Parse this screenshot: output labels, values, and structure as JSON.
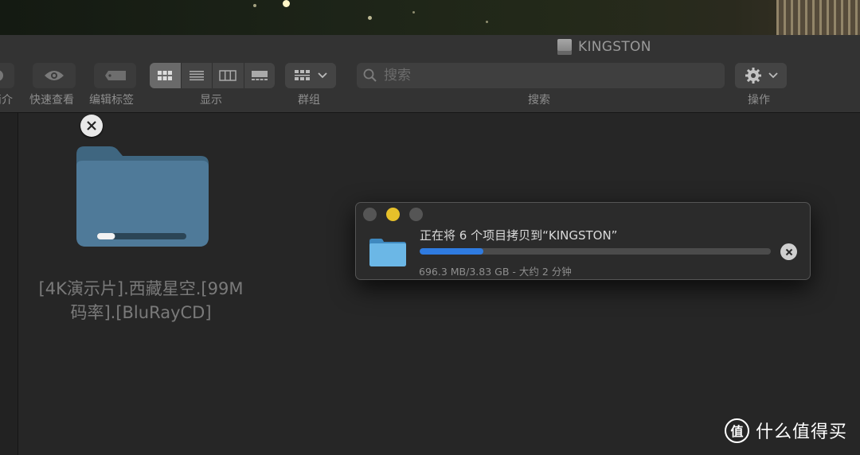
{
  "window": {
    "title": "KINGSTON"
  },
  "toolbar": {
    "info_label": "简介",
    "quicklook_label": "快速查看",
    "edit_tags_label": "编辑标签",
    "view_label": "显示",
    "group_label": "群组",
    "search_label": "搜索",
    "action_label": "操作"
  },
  "search": {
    "placeholder": "搜索"
  },
  "folder": {
    "name": "[4K演示片].西藏星空.[99M码率].[BluRayCD]",
    "name_line1": "[4K演示片].西藏星空.[99M",
    "name_line2": "码率].[BluRayCD]",
    "copy_progress": 0.2
  },
  "copy_dialog": {
    "title": "正在将 6 个项目拷贝到“KINGSTON”",
    "status": "696.3 MB/3.83 GB - 大约 2 分钟",
    "progress_percent": 18.2
  },
  "watermark": {
    "text": "什么值得买",
    "logo_char": "值"
  },
  "colors": {
    "accent": "#2f7be0",
    "minimize": "#e6c02a",
    "folder_body": "#4f7a99",
    "folder_tab": "#3f6680"
  },
  "icons": {
    "info": "info-icon",
    "quicklook": "eye-icon",
    "tag": "tag-icon",
    "view_icon": "grid-icon",
    "view_list": "list-icon",
    "view_columns": "columns-icon",
    "view_gallery": "gallery-icon",
    "group": "group-icon",
    "search": "search-icon",
    "action": "gear-icon",
    "cancel": "close-icon",
    "drive": "drive-icon"
  }
}
